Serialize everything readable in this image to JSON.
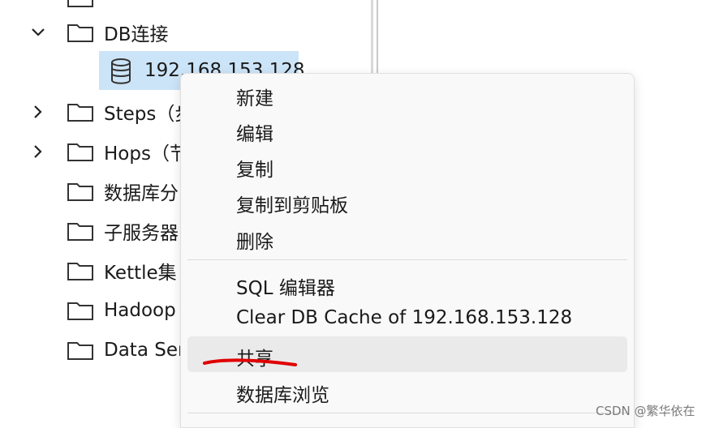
{
  "tree": {
    "items": [
      {
        "label": "DB连接",
        "expanded": true
      },
      {
        "label": "Steps（步"
      },
      {
        "label": "Hops（节"
      },
      {
        "label": "数据库分"
      },
      {
        "label": "子服务器"
      },
      {
        "label": "Kettle集"
      },
      {
        "label": "Hadoop"
      },
      {
        "label": "Data Ser"
      }
    ],
    "connection": {
      "label": "192.168.153.128"
    }
  },
  "context_menu": {
    "items": [
      {
        "label": "新建"
      },
      {
        "label": "编辑"
      },
      {
        "label": "复制"
      },
      {
        "label": "复制到剪贴板"
      },
      {
        "label": "删除"
      },
      {
        "label": "SQL 编辑器"
      },
      {
        "label": "Clear DB Cache of 192.168.153.128"
      },
      {
        "label": "共享",
        "highlighted": true
      },
      {
        "label": "数据库浏览"
      }
    ]
  },
  "watermark": "CSDN @繁华依在",
  "colors": {
    "selection": "#cce4f7",
    "menu_hover": "#eaeaea",
    "annotation": "#e00000"
  }
}
